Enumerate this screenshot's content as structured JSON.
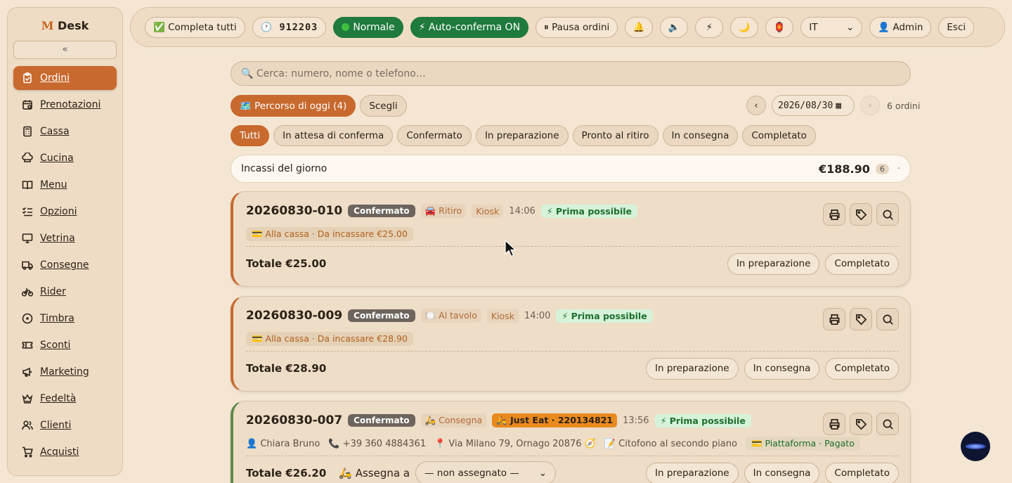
{
  "brand": {
    "m": "M",
    "name": " Desk"
  },
  "sidebar": {
    "collapse_label": "«",
    "items": [
      {
        "label": "Ordini",
        "icon": "clipboard-icon",
        "active": true
      },
      {
        "label": "Prenotazioni",
        "icon": "calendar-icon"
      },
      {
        "label": "Cassa",
        "icon": "calculator-icon"
      },
      {
        "label": "Cucina",
        "icon": "chef-hat-icon"
      },
      {
        "label": "Menu",
        "icon": "book-icon"
      },
      {
        "label": "Opzioni",
        "icon": "list-check-icon"
      },
      {
        "label": "Vetrina",
        "icon": "presentation-icon"
      },
      {
        "label": "Consegne",
        "icon": "truck-icon"
      },
      {
        "label": "Rider",
        "icon": "bike-icon"
      },
      {
        "label": "Timbra",
        "icon": "clock-icon"
      },
      {
        "label": "Sconti",
        "icon": "ticket-icon"
      },
      {
        "label": "Marketing",
        "icon": "megaphone-icon"
      },
      {
        "label": "Fedeltà",
        "icon": "crown-icon"
      },
      {
        "label": "Clienti",
        "icon": "users-icon"
      },
      {
        "label": "Acquisti",
        "icon": "cart-icon"
      }
    ]
  },
  "topbar": {
    "complete_all": "✅ Completa tutti",
    "code": "🕐 912203",
    "mode": "Normale",
    "auto_confirm": "⚡ Auto-conferma ON",
    "pause": "⏸ Pausa ordini",
    "bell": "🔔",
    "speaker": "🔈",
    "bolt": "⚡",
    "moon": "🌙",
    "lantern": "🏮",
    "language": "IT",
    "admin": "👤 Admin",
    "logout": "Esci"
  },
  "search": {
    "placeholder": "🔍 Cerca: numero, nome o telefono…"
  },
  "route": {
    "today": "🗺️ Percorso di oggi (4)",
    "choose": "Scegli"
  },
  "date": {
    "prev": "‹",
    "value": "2026/08/30",
    "next": "›",
    "orders_count": "6 ordini"
  },
  "filters": [
    "Tutti",
    "In attesa di conferma",
    "Confermato",
    "In preparazione",
    "Pronto al ritiro",
    "In consegna",
    "Completato"
  ],
  "income": {
    "title": "Incassi del giorno",
    "amount": "€188.90",
    "count": "6",
    "more": "·"
  },
  "orders": [
    {
      "id": "20260830-010",
      "status": "Confermato",
      "type": "🚘 Ritiro",
      "source": "Kiosk",
      "time": "14:06",
      "asap": "⚡ Prima possibile",
      "payment": "💳 Alla cassa · Da incassare €25.00",
      "total": "Totale €25.00",
      "actions": [
        "In preparazione",
        "Completato"
      ]
    },
    {
      "id": "20260830-009",
      "status": "Confermato",
      "type": "🍽️ Al tavolo",
      "source": "Kiosk",
      "time": "14:00",
      "asap": "⚡ Prima possibile",
      "payment": "💳 Alla cassa · Da incassare €28.90",
      "total": "Totale €28.90",
      "actions": [
        "In preparazione",
        "In consegna",
        "Completato"
      ]
    },
    {
      "id": "20260830-007",
      "status": "Confermato",
      "type": "🛵 Consegna",
      "platform": "🛵 Just Eat · 220134821",
      "time": "13:56",
      "asap": "⚡ Prima possibile",
      "customer": "👤 Chiara Bruno",
      "phone": "📞 +39 360 4884361",
      "address": "📍 Via Milano 79, Ornago 20876 🧭",
      "note": "📝 Citofono al secondo piano",
      "payment": "💳 Piattaforma · Pagato",
      "total": "Totale €26.20",
      "assign_label": "🛵 Assegna a",
      "assign_value": "— non assegnato —",
      "actions": [
        "In preparazione",
        "In consegna",
        "Completato"
      ]
    }
  ]
}
